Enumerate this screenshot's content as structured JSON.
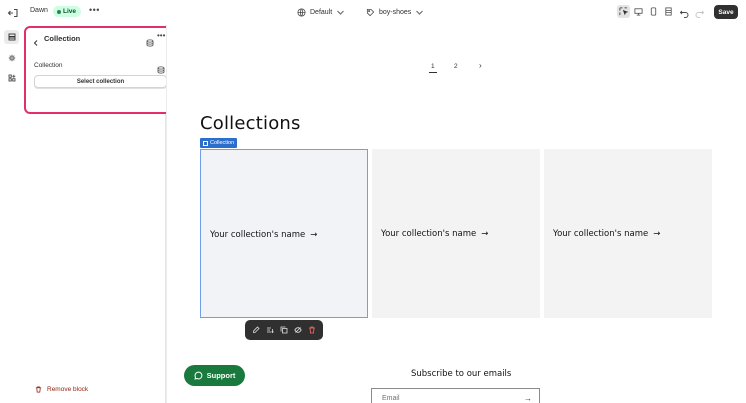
{
  "topbar": {
    "theme_name": "Dawn",
    "live_badge": "Live",
    "more": "•••",
    "template_select": "Default",
    "page_select": "boy-shoes",
    "save_label": "Save"
  },
  "sidebar": {
    "panel_title": "Collection",
    "field_label": "Collection",
    "select_button": "Select collection",
    "remove_block": "Remove block",
    "panel_more": "•••"
  },
  "preview": {
    "pagination": [
      "1",
      "2"
    ],
    "pagination_next": "›",
    "heading": "Collections",
    "selected_tag": "Collection",
    "cards": [
      {
        "label": "Your collection's name",
        "arrow": "→"
      },
      {
        "label": "Your collection's name",
        "arrow": "→"
      },
      {
        "label": "Your collection's name",
        "arrow": "→"
      }
    ],
    "support_button": "Support",
    "subscribe_heading": "Subscribe to our emails",
    "email_placeholder": "Email",
    "email_arrow": "→"
  },
  "colors": {
    "selection_outline": "#e0306a",
    "live_bg": "#cdfee1",
    "support_green": "#1a7a3e",
    "block_tag": "#2c6ecb"
  }
}
